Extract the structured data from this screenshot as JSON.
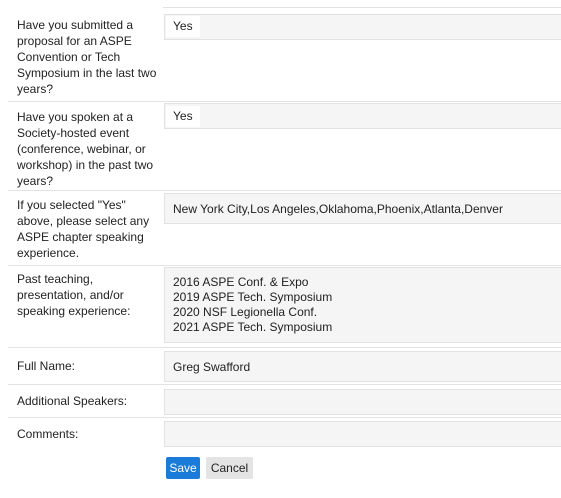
{
  "form": {
    "questions": [
      {
        "label": "Have you submitted a proposal for an ASPE Convention or Tech Symposium in the last two years?",
        "answer": "Yes"
      },
      {
        "label": "Have you spoken at a Society-hosted event (conference, webinar, or workshop) in the past two years?",
        "answer": "Yes"
      },
      {
        "label": "If you selected \"Yes\" above, please select any ASPE chapter speaking experience.",
        "answer": "New York City,Los Angeles,Oklahoma,Phoenix,Atlanta,Denver"
      },
      {
        "label": "Past teaching, presentation, and/or speaking experience:",
        "answer_lines": [
          "2016 ASPE Conf. & Expo",
          "2019 ASPE Tech. Symposium",
          "2020 NSF Legionella Conf.",
          "2021 ASPE Tech. Symposium"
        ]
      },
      {
        "label": "Full Name:",
        "answer": "Greg Swafford"
      },
      {
        "label": "Additional Speakers:",
        "answer": ""
      },
      {
        "label": "Comments:",
        "answer": ""
      }
    ],
    "buttons": {
      "save": "Save",
      "cancel": "Cancel"
    }
  }
}
